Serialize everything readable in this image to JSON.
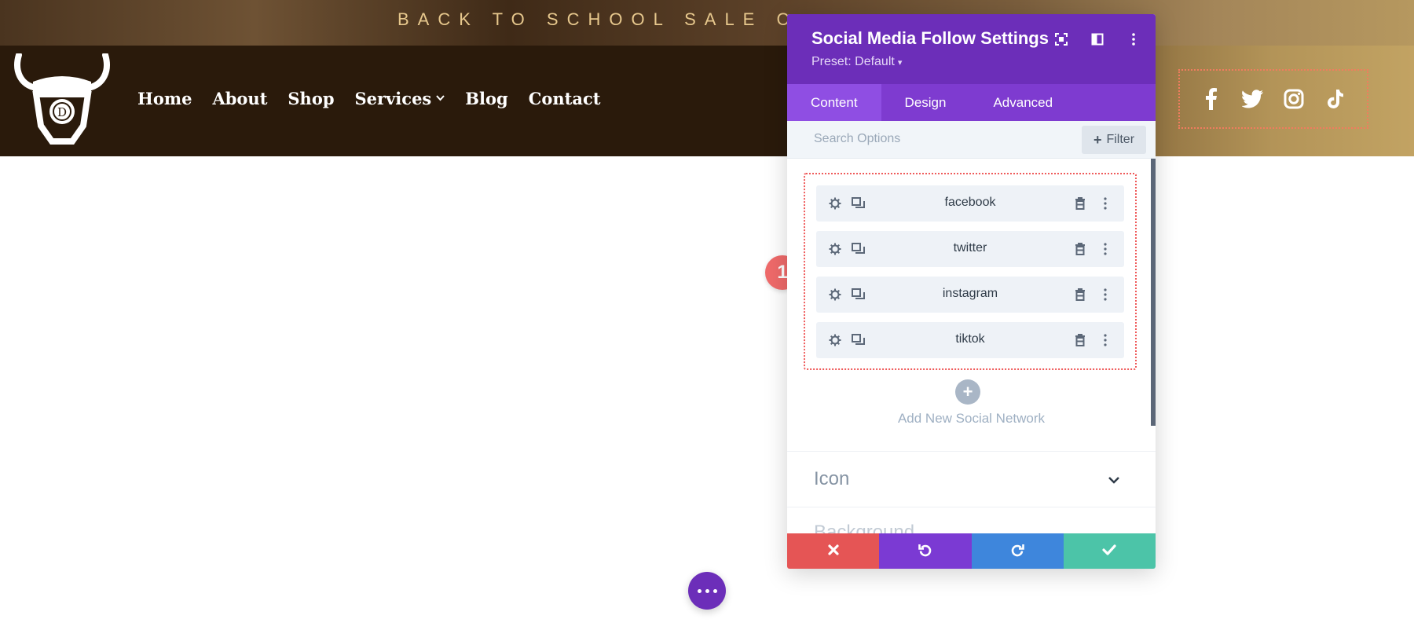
{
  "topbar": {
    "sale_text": "BACK TO SCHOOL SALE C"
  },
  "nav": {
    "items": [
      {
        "label": "Home"
      },
      {
        "label": "About"
      },
      {
        "label": "Shop"
      },
      {
        "label": "Services",
        "has_dropdown": true
      },
      {
        "label": "Blog"
      },
      {
        "label": "Contact"
      }
    ]
  },
  "header_social": [
    "facebook-icon",
    "twitter-icon",
    "instagram-icon",
    "tiktok-icon"
  ],
  "modal": {
    "title": "Social Media Follow Settings",
    "preset": "Preset: Default",
    "tabs": [
      {
        "label": "Content",
        "active": true
      },
      {
        "label": "Design",
        "active": false
      },
      {
        "label": "Advanced",
        "active": false
      }
    ],
    "search_placeholder": "Search Options",
    "filter_label": "Filter",
    "networks": [
      {
        "label": "facebook"
      },
      {
        "label": "twitter"
      },
      {
        "label": "instagram"
      },
      {
        "label": "tiktok"
      }
    ],
    "add_label": "Add New Social Network",
    "sections": [
      {
        "label": "Icon"
      },
      {
        "label": "Background"
      }
    ]
  },
  "annotation": {
    "badge_number": "1"
  },
  "colors": {
    "modal_header": "#6c2eb9",
    "tabs_bar": "#7e3bd0",
    "cancel": "#e55555",
    "undo": "#7b3ad3",
    "redo": "#3e86dc",
    "save": "#4cc4a8",
    "badge": "#ef6a6a"
  }
}
